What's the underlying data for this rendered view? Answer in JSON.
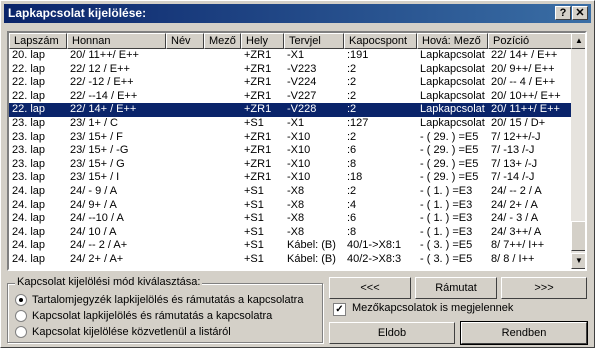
{
  "window": {
    "title": "Lapkapcsolat kijelölése:",
    "help_label": "?",
    "close_label": "✕"
  },
  "table": {
    "columns": [
      "Lapszám",
      "Honnan",
      "Név",
      "Mező",
      "Hely",
      "Tervjel",
      "Kapocspont",
      "Hová: Mező",
      "Pozíció"
    ],
    "rows": [
      [
        "20. lap",
        "20/ 11++/ E++",
        "",
        "",
        "+ZR1",
        "-X1",
        ":191",
        "Lapkapcsolat",
        "22/ 14+ / E++"
      ],
      [
        "22. lap",
        "22/ 12 / E++",
        "",
        "",
        "+ZR1",
        "-V223",
        ":2",
        "Lapkapcsolat",
        "20/ 9++/ E++"
      ],
      [
        "22. lap",
        "22/ -12 / E++",
        "",
        "",
        "+ZR1",
        "-V224",
        ":2",
        "Lapkapcsolat",
        "20/ -- 4 / E++"
      ],
      [
        "22. lap",
        "22/ --14 / E++",
        "",
        "",
        "+ZR1",
        "-V227",
        ":2",
        "Lapkapcsolat",
        "20/ 10++/ E++"
      ],
      [
        "22. lap",
        "22/ 14+ / E++",
        "",
        "",
        "+ZR1",
        "-V228",
        ":2",
        "Lapkapcsolat",
        "20/ 11++/ E++"
      ],
      [
        "23. lap",
        "23/ 1+ / C",
        "",
        "",
        "+S1",
        "-X1",
        ":127",
        "Lapkapcsolat",
        "20/ 15 / D+"
      ],
      [
        "23. lap",
        "23/ 15+ / F",
        "",
        "",
        "+ZR1",
        "-X10",
        ":2",
        "- ( 29. ) =E5",
        "7/ 12++/-J"
      ],
      [
        "23. lap",
        "23/ 15+ / -G",
        "",
        "",
        "+ZR1",
        "-X10",
        ":6",
        "- ( 29. ) =E5",
        "7/ -13 /-J"
      ],
      [
        "23. lap",
        "23/ 15+ / G",
        "",
        "",
        "+ZR1",
        "-X10",
        ":8",
        "- ( 29. ) =E5",
        "7/ 13+ /-J"
      ],
      [
        "23. lap",
        "23/ 15+ / I",
        "",
        "",
        "+ZR1",
        "-X10",
        ":18",
        "- ( 29. ) =E5",
        "7/ -14 /-J"
      ],
      [
        "24. lap",
        "24/ - 9 / A",
        "",
        "",
        "+S1",
        "-X8",
        ":2",
        "- ( 1. ) =E3",
        "24/ -- 2 / A"
      ],
      [
        "24. lap",
        "24/ 9+ / A",
        "",
        "",
        "+S1",
        "-X8",
        ":4",
        "- ( 1. ) =E3",
        "24/ 2+ / A"
      ],
      [
        "24. lap",
        "24/ --10 / A",
        "",
        "",
        "+S1",
        "-X8",
        ":6",
        "- ( 1. ) =E3",
        "24/ - 3 / A"
      ],
      [
        "24. lap",
        "24/ 10 / A",
        "",
        "",
        "+S1",
        "-X8",
        ":8",
        "- ( 1. ) =E3",
        "24/ 3++/ A"
      ],
      [
        "24. lap",
        "24/ -- 2 / A+",
        "",
        "",
        "+S1",
        "Kábel: (B)",
        "40/1->X8:1",
        "- ( 3. ) =E5",
        "8/ 7++/ I++"
      ],
      [
        "24. lap",
        "24/ 2+ / A+",
        "",
        "",
        "+S1",
        "Kábel: (B)",
        "40/2->X8:3",
        "- ( 3. ) =E5",
        "8/ 8 / I++"
      ]
    ],
    "selected_index": 4
  },
  "scrollbar": {
    "up_label": "▲",
    "down_label": "▼"
  },
  "mode_group": {
    "title": "Kapcsolat kijelölési mód kiválasztása:",
    "options": [
      "Tartalomjegyzék lapkijelölés és rámutatás a kapcsolatra",
      "Kapcsolat lapkijelölés és rámutatás a kapcsolatra",
      "Kapcsolat kijelölése közvetlenül a listáról"
    ],
    "selected_index": 0
  },
  "buttons": {
    "prev": "<<<",
    "ramutat": "Rámutat",
    "next": ">>>",
    "eldob": "Eldob",
    "rendben": "Rendben"
  },
  "checkbox": {
    "label": "Mezőkapcsolatok is megjelennek",
    "checked": true,
    "mark": "✓"
  }
}
